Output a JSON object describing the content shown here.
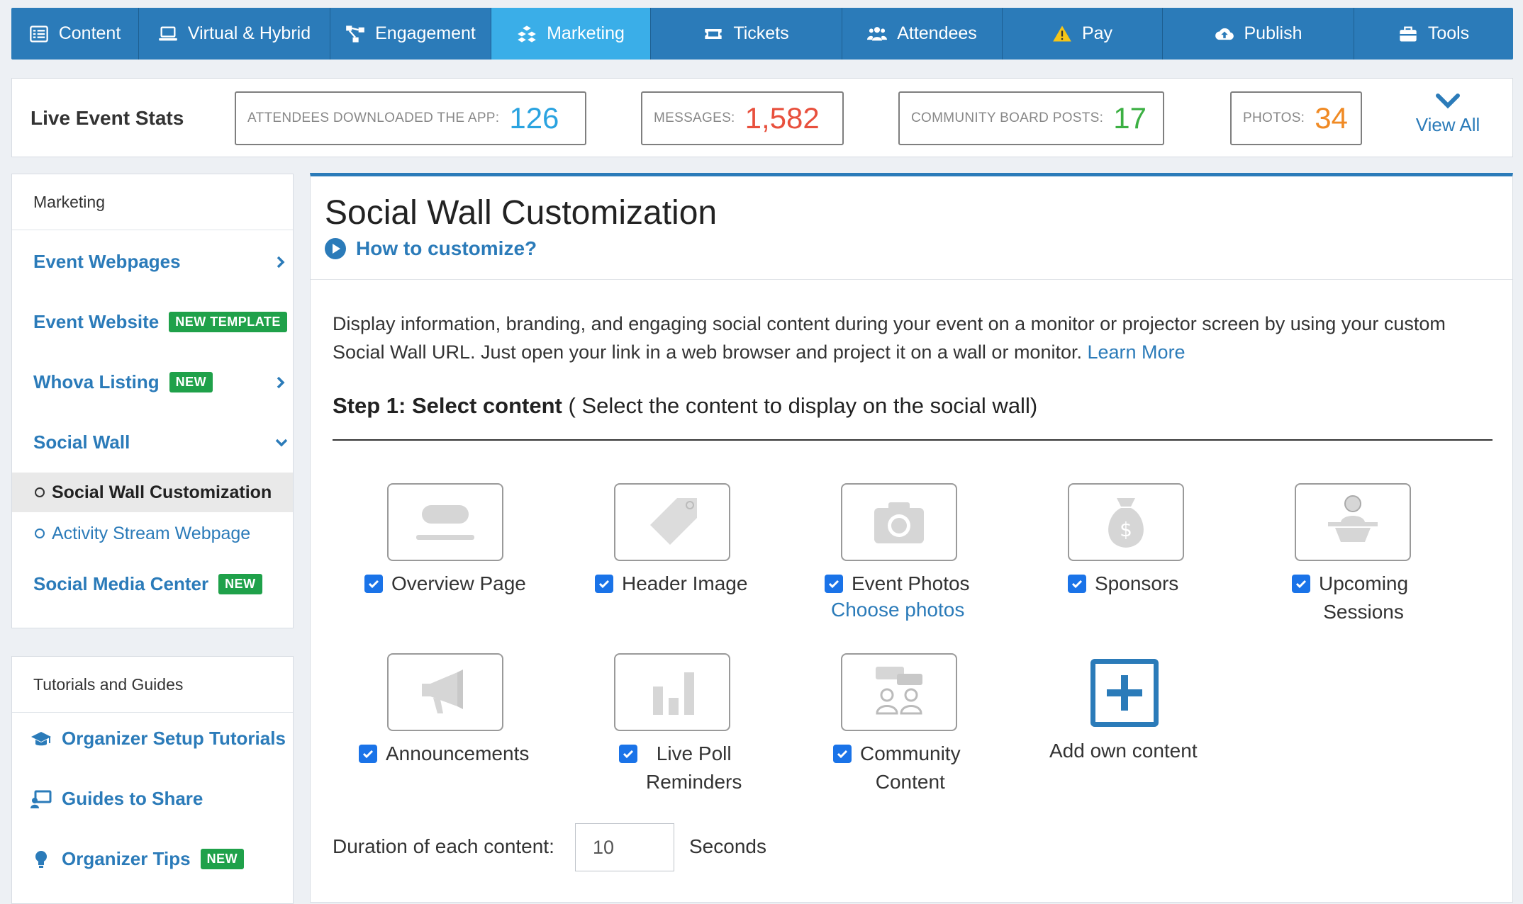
{
  "nav": [
    {
      "label": "Content",
      "icon": "list-icon"
    },
    {
      "label": "Virtual & Hybrid",
      "icon": "laptop-icon"
    },
    {
      "label": "Engagement",
      "icon": "network-icon"
    },
    {
      "label": "Marketing",
      "icon": "cubes-icon",
      "active": true
    },
    {
      "label": "Tickets",
      "icon": "ticket-icon"
    },
    {
      "label": "Attendees",
      "icon": "users-icon"
    },
    {
      "label": "Pay",
      "icon": "warning-icon"
    },
    {
      "label": "Publish",
      "icon": "cloud-upload-icon"
    },
    {
      "label": "Tools",
      "icon": "toolbox-icon"
    }
  ],
  "stats": {
    "title": "Live Event Stats",
    "items": [
      {
        "label": "ATTENDEES DOWNLOADED THE APP:",
        "value": "126",
        "color": "#2aa3e0"
      },
      {
        "label": "MESSAGES:",
        "value": "1,582",
        "color": "#e8503d"
      },
      {
        "label": "COMMUNITY BOARD POSTS:",
        "value": "17",
        "color": "#3cb043"
      },
      {
        "label": "PHOTOS:",
        "value": "34",
        "color": "#f08a24"
      }
    ],
    "view_all": "View All"
  },
  "sidebar": {
    "heading": "Marketing",
    "items": [
      {
        "label": "Event Webpages"
      },
      {
        "label": "Event Website",
        "badge": "NEW TEMPLATE"
      },
      {
        "label": "Whova Listing",
        "badge": "NEW"
      },
      {
        "label": "Social Wall"
      }
    ],
    "sub_items": [
      {
        "label": "Social Wall Customization"
      },
      {
        "label": "Activity Stream Webpage"
      }
    ],
    "media": {
      "label": "Social Media Center",
      "badge": "NEW"
    }
  },
  "tutorials": {
    "heading": "Tutorials and Guides",
    "items": [
      {
        "label": "Organizer Setup Tutorials",
        "icon": "graduation-cap-icon"
      },
      {
        "label": "Guides to Share",
        "icon": "share-screen-icon"
      },
      {
        "label": "Organizer Tips",
        "icon": "lightbulb-icon",
        "badge": "NEW"
      }
    ]
  },
  "main": {
    "title": "Social Wall Customization",
    "howto": "How to customize?",
    "description": "Display information, branding, and engaging social content during your event on a monitor or projector screen by using your custom Social Wall URL. Just open your link in a web browser and project it on a wall or monitor.",
    "learn_more": "Learn More",
    "step_bold": "Step 1: Select content",
    "step_rest": " ( Select the content to display on the social wall)",
    "options": [
      {
        "line1": "Overview Page",
        "line2": "",
        "checked": true
      },
      {
        "line1": "Header Image",
        "line2": "",
        "checked": true
      },
      {
        "line1": "Event Photos",
        "line2": "",
        "checked": true
      },
      {
        "line1": "Sponsors",
        "line2": "",
        "checked": true
      },
      {
        "line1": "Upcoming",
        "line2": "Sessions",
        "checked": true
      },
      {
        "line1": "Announcements",
        "line2": "",
        "checked": true
      },
      {
        "line1": "Live Poll",
        "line2": "Reminders",
        "checked": true
      },
      {
        "line1": "Community",
        "line2": "Content",
        "checked": true
      }
    ],
    "choose_photos": "Choose photos",
    "add_own": "Add own content",
    "duration_label": "Duration of each content:",
    "duration_value": "10",
    "duration_unit": "Seconds"
  }
}
